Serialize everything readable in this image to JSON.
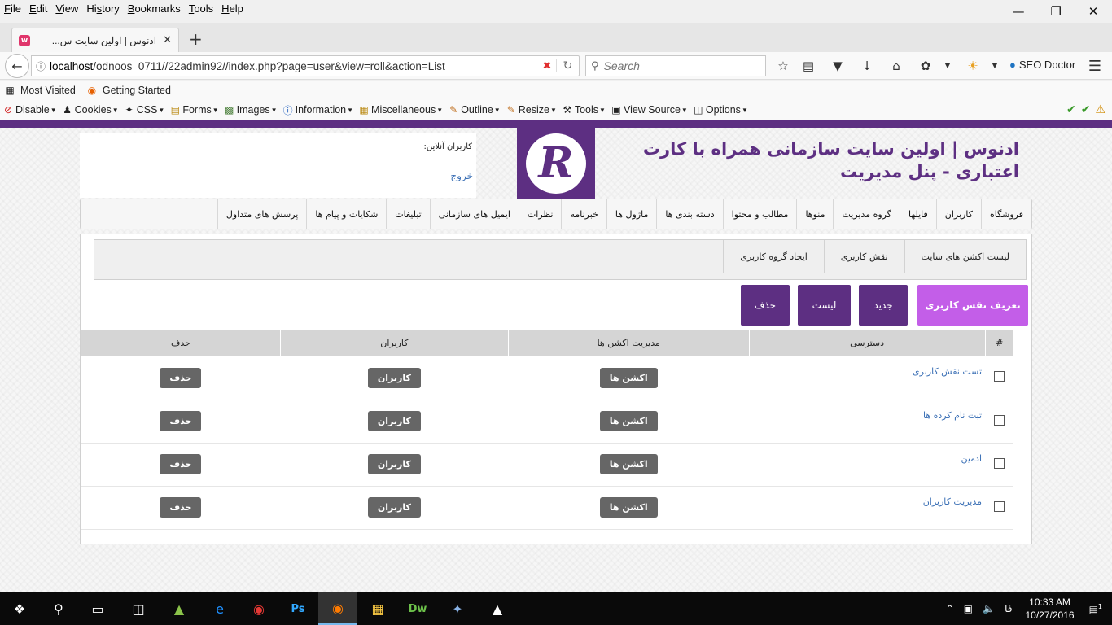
{
  "menubar": {
    "items": [
      "File",
      "Edit",
      "View",
      "History",
      "Bookmarks",
      "Tools",
      "Help"
    ],
    "accesskeys": [
      "F",
      "E",
      "V",
      "s",
      "B",
      "T",
      "H"
    ]
  },
  "tab": {
    "title": "ادنوس | اولین سایت س..."
  },
  "navbar": {
    "url_host": "localhost",
    "url_rest": "/odnoos_0711//22admin92//index.php?page=user&view=roll&action=List",
    "search_placeholder": "Search",
    "seo_doctor": "SEO Doctor"
  },
  "bookmarks": [
    "Most Visited",
    "Getting Started"
  ],
  "devbar": [
    "Disable",
    "Cookies",
    "CSS",
    "Forms",
    "Images",
    "Information",
    "Miscellaneous",
    "Outline",
    "Resize",
    "Tools",
    "View Source",
    "Options"
  ],
  "header": {
    "online_label": "کاربران آنلاین:",
    "logout": "خروج",
    "logo_letter": "R",
    "title_line1": "ادنوس | اولین سایت سازمانی همراه با کارت",
    "title_line2": "اعتباری - پنل مدیریت"
  },
  "main_nav": [
    "فروشگاه",
    "کاربران",
    "فایلها",
    "گروه مدیریت",
    "منوها",
    "مطالب و محتوا",
    "دسته بندی ها",
    "ماژول ها",
    "خبرنامه",
    "نظرات",
    "ایمیل های سازمانی",
    "تبلیغات",
    "شکایات و پیام ها",
    "پرسش های متداول"
  ],
  "sub_nav": [
    "لیست اکشن های سایت",
    "نقش کاربری",
    "ایجاد گروه کاربری"
  ],
  "actions": {
    "define": "تعریف نقش کاربری",
    "new": "جدید",
    "list": "لیست",
    "delete": "حذف"
  },
  "table": {
    "headers": [
      "#",
      "دسترسی",
      "مدیریت اکشن ها",
      "کاربران",
      "حذف"
    ],
    "rows": [
      {
        "name": "تست نقش کاربری",
        "actions": "اکشن ها",
        "users": "کاربران",
        "delete": "حذف"
      },
      {
        "name": "ثبت نام کرده ها",
        "actions": "اکشن ها",
        "users": "کاربران",
        "delete": "حذف"
      },
      {
        "name": "ادمین",
        "actions": "اکشن ها",
        "users": "کاربران",
        "delete": "حذف"
      },
      {
        "name": "مدیریت کاربران",
        "actions": "اکشن ها",
        "users": "کاربران",
        "delete": "حذف"
      }
    ]
  },
  "taskbar": {
    "time": "10:33 AM",
    "date": "10/27/2016",
    "lang": "فا",
    "notification_count": "1"
  },
  "colors": {
    "brand_purple": "#5d2f82",
    "define_button": "#c35ee8",
    "link": "#3a6fb5"
  }
}
